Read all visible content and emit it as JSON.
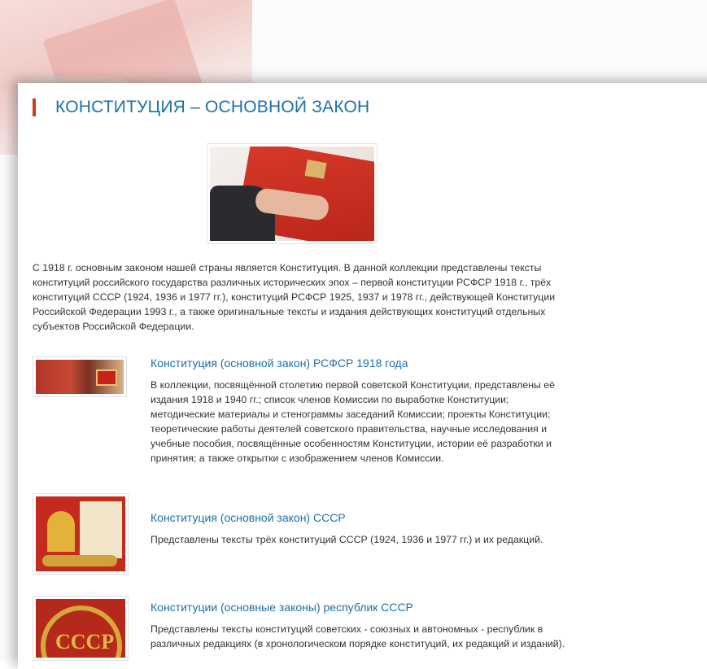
{
  "title": "КОНСТИТУЦИЯ – ОСНОВНОЙ ЗАКОН",
  "intro": "С 1918 г. основным законом нашей страны является Конституция. В данной коллекции представлены тексты конституций российского государства различных исторических эпох – первой конституции РСФСР 1918 г., трёх конституций СССР (1924, 1936 и 1977 гг.), конституций РСФСР 1925, 1937 и 1978 гг., действующей Конституции Российской Федерации 1993 г., а также оригинальные тексты и издания действующих конституций отдельных субъектов Российской Федерации.",
  "items": [
    {
      "title": "Конституция (основной закон) РСФСР 1918 года",
      "description": "В коллекции, посвящённой столетию первой советской Конституции, представлены её издания 1918 и 1940 гг.; список членов Комиссии по выработке Конституции; методические материалы и стенограммы заседаний Комиссии; проекты Конституции; теоретические работы деятелей советского правительства, научные исследования и учебные пособия, посвящённые особенностям Конституции, истории её разработки и принятия; а также открытки с изображением членов Комиссии."
    },
    {
      "title": "Конституция (основной закон) СССР",
      "description": "Представлены тексты трёх конституций СССР (1924, 1936 и 1977 гг.) и их редакций."
    },
    {
      "title": "Конституции (основные законы) республик СССР",
      "description": "Представлены тексты конституций советских - союзных и автономных - республик в различных редакциях (в хронологическом порядке конституций, их редакций и изданий)."
    }
  ],
  "thumbs": {
    "item3_text": "СССР"
  },
  "colors": {
    "accent": "#d23a24",
    "link": "#1e6fa7",
    "text": "#333333"
  }
}
